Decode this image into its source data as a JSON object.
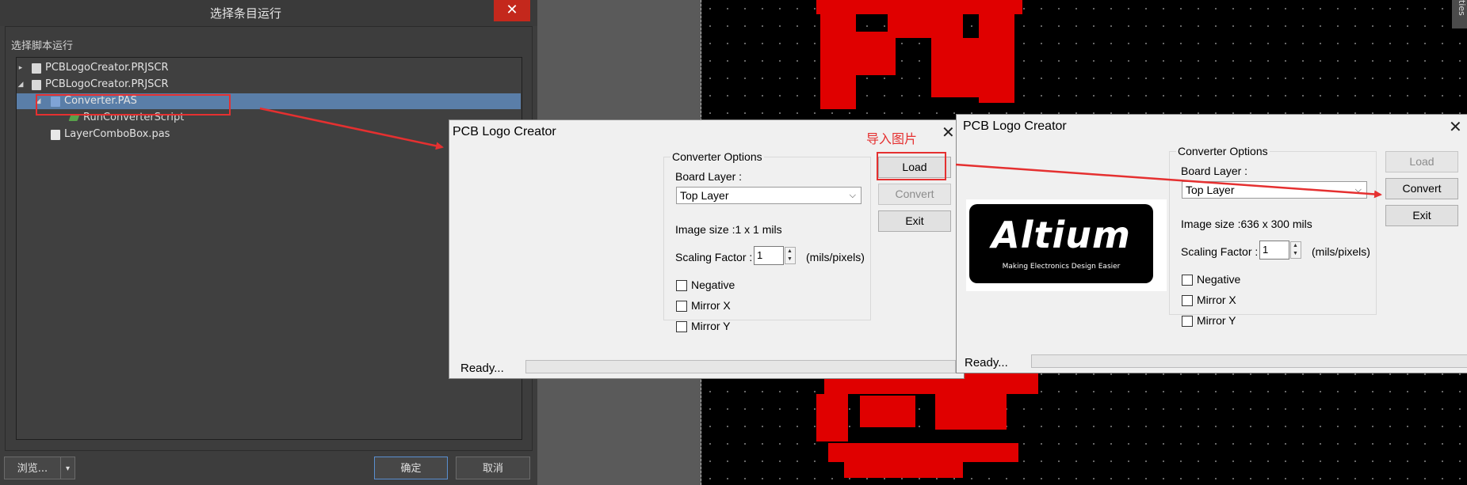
{
  "runner": {
    "title": "选择条目运行",
    "close": "✕",
    "section": "选择脚本运行",
    "tree": [
      {
        "label": "PCBLogoCreator.PRJSCR",
        "arrow": "▸"
      },
      {
        "label": "PCBLogoCreator.PRJSCR",
        "arrow": "◢"
      },
      {
        "label": "Converter.PAS",
        "arrow": "◢"
      },
      {
        "label": "RunConverterScript"
      },
      {
        "label": "LayerComboBox.pas"
      }
    ],
    "browse": "浏览...",
    "browse_arrow": "▾",
    "ok": "确定",
    "cancel": "取消"
  },
  "dialog1": {
    "title": "PCB Logo Creator",
    "close": "✕",
    "group": "Converter Options",
    "board_layer_label": "Board Layer :",
    "board_layer_value": "Top Layer",
    "image_size": "Image size :1 x 1 mils",
    "scaling_label": "Scaling Factor :",
    "scaling_value": "1",
    "scaling_unit": "(mils/pixels)",
    "negative": "Negative",
    "mirror_x": "Mirror X",
    "mirror_y": "Mirror Y",
    "load": "Load",
    "convert": "Convert",
    "exit": "Exit",
    "status": "Ready..."
  },
  "dialog2": {
    "title": "PCB Logo Creator",
    "close": "✕",
    "group": "Converter Options",
    "board_layer_label": "Board Layer :",
    "board_layer_value": "Top Layer",
    "image_size": "Image size :636 x 300 mils",
    "scaling_label": "Scaling Factor :",
    "scaling_value": "1",
    "scaling_unit": "(mils/pixels)",
    "negative": "Negative",
    "mirror_x": "Mirror X",
    "mirror_y": "Mirror Y",
    "load": "Load",
    "convert": "Convert",
    "exit": "Exit",
    "status": "Ready...",
    "logo_text": "Altium",
    "logo_tagline": "Making Electronics Design Easier"
  },
  "annotation": "导入图片",
  "side_tab": "ties",
  "colors": {
    "annotation": "#e53030",
    "pcb_red": "#e00000",
    "selection": "#5a7ea8"
  }
}
